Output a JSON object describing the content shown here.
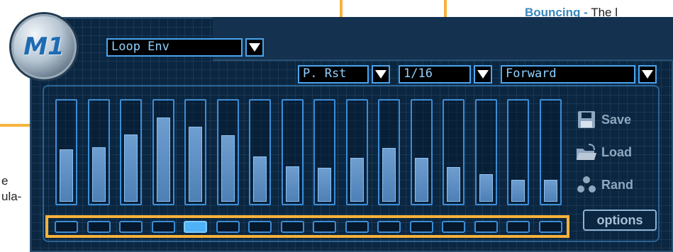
{
  "header": {
    "logo_text": "M1",
    "source_dropdown": {
      "value": "Loop Env"
    }
  },
  "controls": {
    "retrigger_dropdown": {
      "value": "P. Rst"
    },
    "rate_dropdown": {
      "value": "1/16"
    },
    "direction_dropdown": {
      "value": "Forward"
    }
  },
  "sequencer": {
    "step_values": [
      0.53,
      0.55,
      0.68,
      0.85,
      0.76,
      0.67,
      0.46,
      0.36,
      0.34,
      0.44,
      0.54,
      0.44,
      0.35,
      0.28,
      0.22,
      0.22
    ],
    "active_step_index": 4
  },
  "side_buttons": {
    "save_label": "Save",
    "load_label": "Load",
    "rand_label": "Rand",
    "options_label": "options"
  },
  "annotations": {
    "caption_bold": "Bouncing -",
    "caption_text": "The l",
    "left_text_1": "e",
    "left_text_2": "ula-"
  },
  "colors": {
    "panel_bg": "#0b2640",
    "accent_blue": "#4aa5ef",
    "callout_orange": "#f7b23b",
    "caption_blue": "#3a86b9"
  }
}
